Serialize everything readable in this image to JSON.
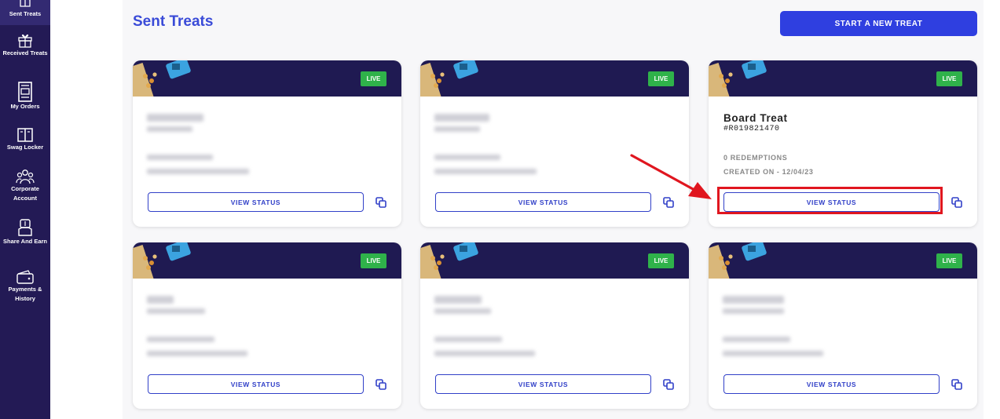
{
  "sidebar": {
    "items": [
      {
        "label": "Sent Treats",
        "icon": "gift-box-icon",
        "active": true
      },
      {
        "label": "Received Treats",
        "icon": "gift-icon",
        "active": false
      },
      {
        "label": "My Orders",
        "icon": "receipt-icon",
        "active": false
      },
      {
        "label": "Swag Locker",
        "icon": "locker-icon",
        "active": false
      },
      {
        "label": "Corporate Account",
        "icon": "team-icon",
        "active": false
      },
      {
        "label": "Share And Earn",
        "icon": "hand-coin-icon",
        "active": false
      },
      {
        "label": "Payments & History",
        "icon": "wallet-icon",
        "active": false
      }
    ]
  },
  "header": {
    "title": "Sent Treats",
    "new_button_label": "START A NEW TREAT"
  },
  "cards": [
    {
      "status": "LIVE",
      "button_label": "VIEW STATUS",
      "name": "",
      "id": "",
      "redemptions": "",
      "created": ""
    },
    {
      "status": "LIVE",
      "button_label": "VIEW STATUS",
      "name": "",
      "id": "",
      "redemptions": "",
      "created": ""
    },
    {
      "status": "LIVE",
      "button_label": "VIEW STATUS",
      "name": "Board Treat",
      "id": "#R019821470",
      "redemptions": "0 REDEMPTIONS",
      "created": "CREATED ON - 12/04/23"
    },
    {
      "status": "LIVE",
      "button_label": "VIEW STATUS",
      "name": "",
      "id": "",
      "redemptions": "",
      "created": ""
    },
    {
      "status": "LIVE",
      "button_label": "VIEW STATUS",
      "name": "",
      "id": "",
      "redemptions": "",
      "created": ""
    },
    {
      "status": "LIVE",
      "button_label": "VIEW STATUS",
      "name": "",
      "id": "",
      "redemptions": "",
      "created": ""
    }
  ],
  "colors": {
    "sidebar_bg": "#231a55",
    "banner_bg": "#1f1a52",
    "accent": "#3a4bd8",
    "live_badge": "#2fb24a",
    "highlight": "#e0161f"
  }
}
